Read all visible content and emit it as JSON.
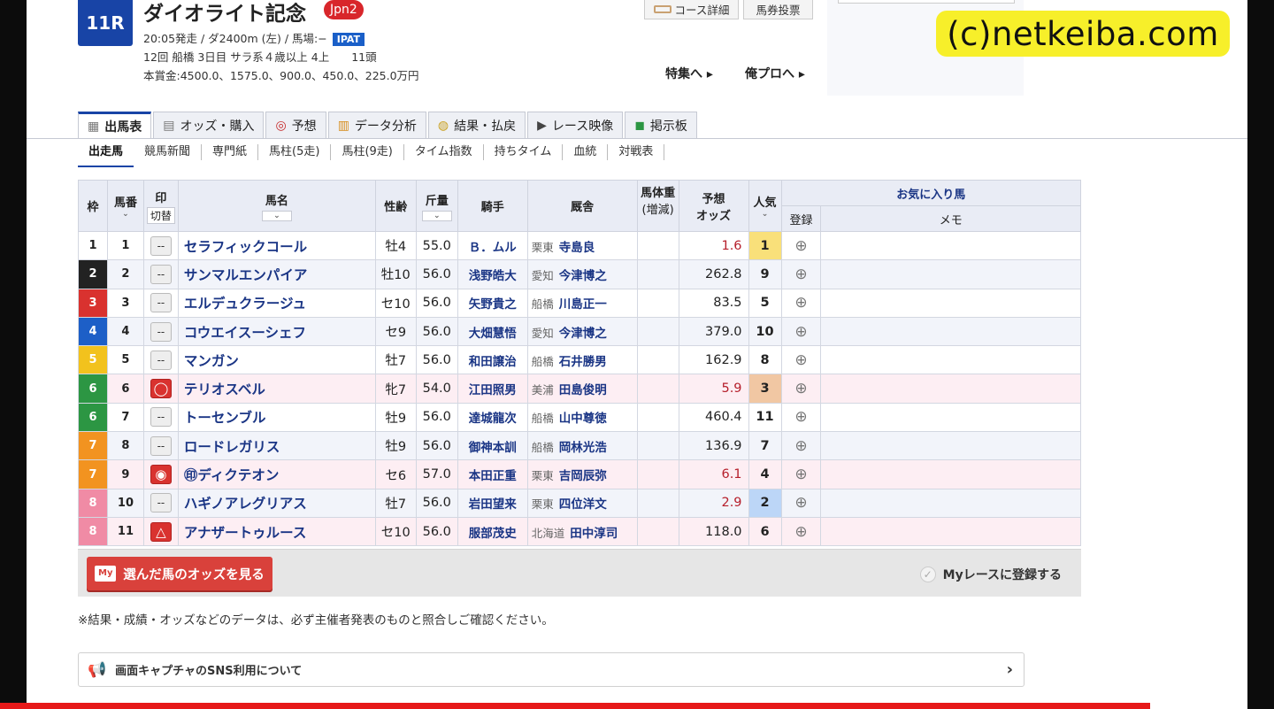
{
  "race": {
    "number": "11R",
    "title": "ダイオライト記念",
    "grade": "Jpn2",
    "info_line1": "20:05発走 / ダ2400m (左) / 馬場:−",
    "ipat": "IPAT",
    "info_line2": "12回 船橋 3日目 サラ系４歳以上 4上　　11頭",
    "prize": "本賞金:4500.0、1575.0、900.0、450.0、225.0万円"
  },
  "top_buttons": {
    "course": "コース詳細",
    "vote": "馬券投票"
  },
  "links": {
    "feature": "特集へ ▸",
    "pro": "俺プロへ ▸"
  },
  "watermark": "(c)netkeiba.com",
  "tabs": [
    {
      "label": "出馬表",
      "icon": "table-icon"
    },
    {
      "label": "オッズ・購入",
      "icon": "odds-icon"
    },
    {
      "label": "予想",
      "icon": "target-icon"
    },
    {
      "label": "データ分析",
      "icon": "bar-chart-icon"
    },
    {
      "label": "結果・払戻",
      "icon": "coins-icon"
    },
    {
      "label": "レース映像",
      "icon": "video-icon"
    },
    {
      "label": "掲示板",
      "icon": "chat-icon"
    }
  ],
  "subtabs": [
    "出走馬",
    "競馬新聞",
    "専門紙",
    "馬柱(5走)",
    "馬柱(9走)",
    "タイム指数",
    "持ちタイム",
    "血統",
    "対戦表"
  ],
  "headers": {
    "waku": "枠",
    "umaban": "馬番",
    "mark": "印",
    "mark_sub": "切替",
    "name": "馬名",
    "sexage": "性齢",
    "weight": "斤量",
    "jockey": "騎手",
    "stable": "厩舎",
    "body": "馬体重",
    "body_sub": "(増減)",
    "odds": "予想",
    "odds_sub": "オッズ",
    "pop": "人気",
    "fav": "お気に入り馬",
    "reg": "登録",
    "memo": "メモ"
  },
  "horses": [
    {
      "waku": "1",
      "umaban": "1",
      "mark": "--",
      "name": "セラフィックコール",
      "sexage": "牡4",
      "weight": "55.0",
      "jockey": "Ｂ．ムル",
      "area": "栗東",
      "trainer": "寺島良",
      "odds": "1.6",
      "pop": "1"
    },
    {
      "waku": "2",
      "umaban": "2",
      "mark": "--",
      "name": "サンマルエンパイア",
      "sexage": "牡10",
      "weight": "56.0",
      "jockey": "浅野皓大",
      "area": "愛知",
      "trainer": "今津博之",
      "odds": "262.8",
      "pop": "9"
    },
    {
      "waku": "3",
      "umaban": "3",
      "mark": "--",
      "name": "エルデュクラージュ",
      "sexage": "セ10",
      "weight": "56.0",
      "jockey": "矢野貴之",
      "area": "船橋",
      "trainer": "川島正一",
      "odds": "83.5",
      "pop": "5"
    },
    {
      "waku": "4",
      "umaban": "4",
      "mark": "--",
      "name": "コウエイスーシェフ",
      "sexage": "セ9",
      "weight": "56.0",
      "jockey": "大畑慧悟",
      "area": "愛知",
      "trainer": "今津博之",
      "odds": "379.0",
      "pop": "10"
    },
    {
      "waku": "5",
      "umaban": "5",
      "mark": "--",
      "name": "マンガン",
      "sexage": "牡7",
      "weight": "56.0",
      "jockey": "和田譲治",
      "area": "船橋",
      "trainer": "石井勝男",
      "odds": "162.9",
      "pop": "8"
    },
    {
      "waku": "6",
      "umaban": "6",
      "mark": "◯",
      "name": "テリオスベル",
      "sexage": "牝7",
      "weight": "54.0",
      "jockey": "江田照男",
      "area": "美浦",
      "trainer": "田島俊明",
      "odds": "5.9",
      "pop": "3"
    },
    {
      "waku": "6",
      "umaban": "7",
      "mark": "--",
      "name": "トーセンブル",
      "sexage": "牡9",
      "weight": "56.0",
      "jockey": "達城龍次",
      "area": "船橋",
      "trainer": "山中尊徳",
      "odds": "460.4",
      "pop": "11"
    },
    {
      "waku": "7",
      "umaban": "8",
      "mark": "--",
      "name": "ロードレガリス",
      "sexage": "牡9",
      "weight": "56.0",
      "jockey": "御神本訓",
      "area": "船橋",
      "trainer": "岡林光浩",
      "odds": "136.9",
      "pop": "7"
    },
    {
      "waku": "7",
      "umaban": "9",
      "mark": "◉",
      "name": "㊞ディクテオン",
      "sexage": "セ6",
      "weight": "57.0",
      "jockey": "本田正重",
      "area": "栗東",
      "trainer": "吉岡辰弥",
      "odds": "6.1",
      "pop": "4"
    },
    {
      "waku": "8",
      "umaban": "10",
      "mark": "--",
      "name": "ハギノアレグリアス",
      "sexage": "牡7",
      "weight": "56.0",
      "jockey": "岩田望来",
      "area": "栗東",
      "trainer": "四位洋文",
      "odds": "2.9",
      "pop": "2"
    },
    {
      "waku": "8",
      "umaban": "11",
      "mark": "△",
      "name": "アナザートゥルース",
      "sexage": "セ10",
      "weight": "56.0",
      "jockey": "服部茂史",
      "area": "北海道",
      "trainer": "田中淳司",
      "odds": "118.0",
      "pop": "6"
    }
  ],
  "footer": {
    "odds_button": "選んだ馬のオッズを見る",
    "my_badge": "My",
    "myrace": "Myレースに登録する",
    "note": "※結果・成績・オッズなどのデータは、必ず主催者発表のものと照合しご確認ください。",
    "sns": "画面キャプチャのSNS利用について"
  }
}
